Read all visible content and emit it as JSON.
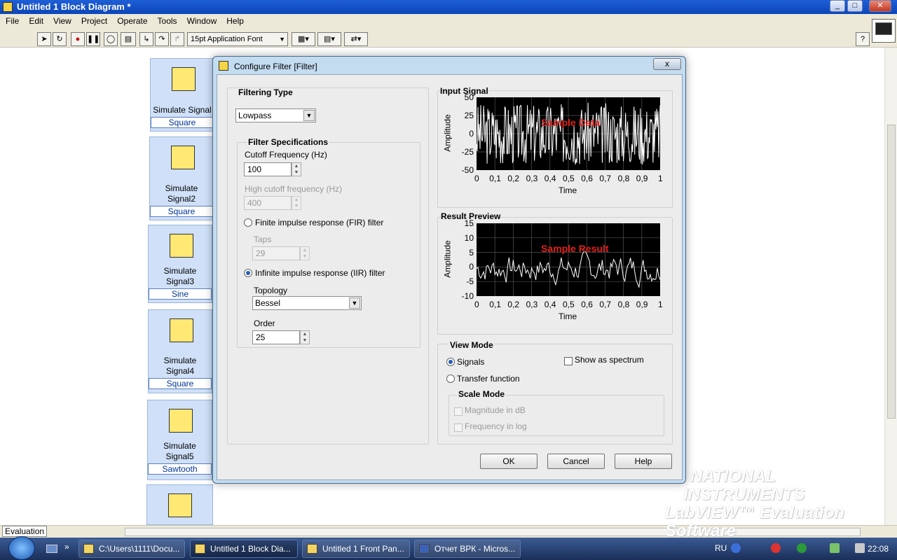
{
  "window": {
    "title": "Untitled 1 Block Diagram *"
  },
  "menu": [
    "File",
    "Edit",
    "View",
    "Project",
    "Operate",
    "Tools",
    "Window",
    "Help"
  ],
  "toolbar": {
    "font": "15pt Application Font",
    "help": "?"
  },
  "block_diagram": {
    "express_vis": [
      {
        "name_line1": "Simulate Signal",
        "name_line2": "",
        "signal_type": "Square"
      },
      {
        "name_line1": "Simulate",
        "name_line2": "Signal2",
        "signal_type": "Square"
      },
      {
        "name_line1": "Simulate",
        "name_line2": "Signal3",
        "signal_type": "Sine"
      },
      {
        "name_line1": "Simulate",
        "name_line2": "Signal4",
        "signal_type": "Square"
      },
      {
        "name_line1": "Simulate",
        "name_line2": "Signal5",
        "signal_type": "Sawtooth"
      }
    ]
  },
  "dialog": {
    "title": "Configure Filter [Filter]",
    "close_label": "x",
    "filtering_type": {
      "label": "Filtering Type",
      "value": "Lowpass"
    },
    "filter_specs": {
      "label": "Filter Specifications",
      "cutoff_label": "Cutoff Frequency (Hz)",
      "cutoff_value": "100",
      "high_cutoff_label": "High cutoff frequency (Hz)",
      "high_cutoff_value": "400",
      "fir_label": "Finite impulse response (FIR) filter",
      "taps_label": "Taps",
      "taps_value": "29",
      "iir_label": "Infinite impulse response (IIR) filter",
      "topology_label": "Topology",
      "topology_value": "Bessel",
      "order_label": "Order",
      "order_value": "25"
    },
    "input_signal": {
      "label": "Input Signal",
      "ylabel": "Amplitude",
      "xlabel": "Time",
      "yticks": [
        "50",
        "25",
        "0",
        "-25",
        "-50"
      ],
      "xticks": [
        "0",
        "0,1",
        "0,2",
        "0,3",
        "0,4",
        "0,5",
        "0,6",
        "0,7",
        "0,8",
        "0,9",
        "1"
      ],
      "overlay": "Sample Data"
    },
    "result_preview": {
      "label": "Result Preview",
      "ylabel": "Amplitude",
      "xlabel": "Time",
      "yticks": [
        "15",
        "10",
        "5",
        "0",
        "-5",
        "-10"
      ],
      "xticks": [
        "0",
        "0,1",
        "0,2",
        "0,3",
        "0,4",
        "0,5",
        "0,6",
        "0,7",
        "0,8",
        "0,9",
        "1"
      ],
      "overlay": "Sample Result"
    },
    "view_mode": {
      "label": "View Mode",
      "signals": "Signals",
      "transfer": "Transfer function",
      "spectrum": "Show as spectrum",
      "scale_label": "Scale Mode",
      "mag_db": "Magnitude in dB",
      "freq_log": "Frequency in log"
    },
    "buttons": {
      "ok": "OK",
      "cancel": "Cancel",
      "help": "Help"
    }
  },
  "watermark": {
    "line1": "NATIONAL",
    "line2": "INSTRUMENTS",
    "line3": "LabVIEW™ Evaluation Software"
  },
  "status": {
    "evaluation": "Evaluation"
  },
  "taskbar": {
    "tasks": [
      "C:\\Users\\1111\\Docu...",
      "Untitled 1 Block Dia...",
      "Untitled 1 Front Pan...",
      "Отчет ВРК - Micros..."
    ],
    "lang": "RU",
    "time": "22:08"
  },
  "colors": {
    "title_bar": "#0c46b8",
    "dialog_frame": "#c3dcf0",
    "overlay_text": "#e0201c",
    "vi_bg": "#cfe0f8"
  }
}
